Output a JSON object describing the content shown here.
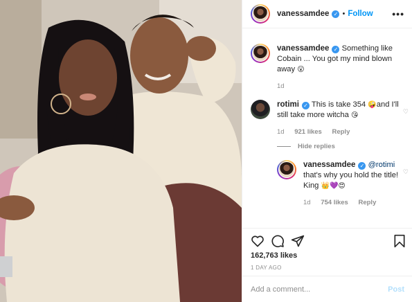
{
  "post": {
    "photo_alt": "",
    "author": "vanessamdee",
    "follow_label": "Follow",
    "more_label": "•••"
  },
  "caption": {
    "username": "vanessamdee",
    "text": "Something like Cobain ... You got my mind blown away",
    "emoji": "😮",
    "time": "1d"
  },
  "comments": [
    {
      "username": "rotimi",
      "text": "This is take 354 ",
      "emoji1": "🤪",
      "text2": "and I'll still take more witcha ",
      "emoji2": "😘",
      "time": "1d",
      "likes": "921 likes",
      "reply_label": "Reply"
    }
  ],
  "hide_replies_label": "Hide replies",
  "reply": {
    "username": "vanessamdee",
    "mention": "@rotimi",
    "text": " that's why you hold the title! King ",
    "emoji": "👑💜😍",
    "time": "1d",
    "likes": "754 likes",
    "reply_label": "Reply"
  },
  "stats": {
    "likes": "162,763 likes",
    "ago": "1 DAY AGO"
  },
  "composer": {
    "placeholder": "Add a comment...",
    "post_label": "Post"
  },
  "icons": {
    "verified": "verified-badge-icon",
    "heart": "heart-icon",
    "comment": "comment-icon",
    "share": "share-icon",
    "save": "bookmark-icon"
  },
  "colors": {
    "link_blue": "#0095f6",
    "muted": "#8e8e8e",
    "post_disabled": "#b2dffc",
    "border": "#efefef"
  }
}
